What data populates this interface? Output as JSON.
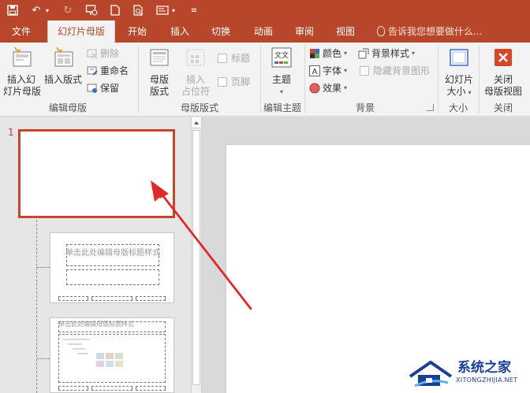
{
  "tabs": [
    {
      "label": "文件"
    },
    {
      "label": "幻灯片母版"
    },
    {
      "label": "开始"
    },
    {
      "label": "插入"
    },
    {
      "label": "切换"
    },
    {
      "label": "动画"
    },
    {
      "label": "审阅"
    },
    {
      "label": "视图"
    }
  ],
  "tell_me": "告诉我您想要做什么...",
  "ribbon": {
    "edit_master": {
      "label": "编辑母版",
      "insert_slide_master": [
        "插入幻",
        "灯片母版"
      ],
      "insert_layout": "插入版式",
      "delete": "删除",
      "rename": "重命名",
      "preserve": "保留"
    },
    "master_layout": {
      "label": "母版版式",
      "master_layout_btn": [
        "母版",
        "版式"
      ],
      "insert_placeholder": [
        "插入",
        "占位符"
      ],
      "title": "标题",
      "footer": "页脚"
    },
    "edit_theme": {
      "label": "编辑主题",
      "themes": "主题",
      "theme_icon_text": "文文"
    },
    "background": {
      "label": "背景",
      "colors": "颜色",
      "fonts": "字体",
      "effects": "效果",
      "background_styles": "背景样式",
      "hide_background": "隐藏背景图形"
    },
    "size": {
      "label": "大小",
      "slide_size": [
        "幻灯片",
        "大小"
      ]
    },
    "close": {
      "label": "关闭",
      "close_master_view": [
        "关闭",
        "母版视图"
      ]
    }
  },
  "thumbnails": {
    "slide_number": "1",
    "layout1_title": "单击此处编辑母版标题样式",
    "layout2_title": "单击此处编辑母版标题样式"
  },
  "watermark": {
    "text": "系统之家",
    "subtext": "XITONGZHIJIA.NET"
  },
  "colors": {
    "accent": "#b7472a",
    "selection_border": "#c4472b",
    "arrow": "#e02a2a",
    "close_icon": "#d9472b"
  }
}
